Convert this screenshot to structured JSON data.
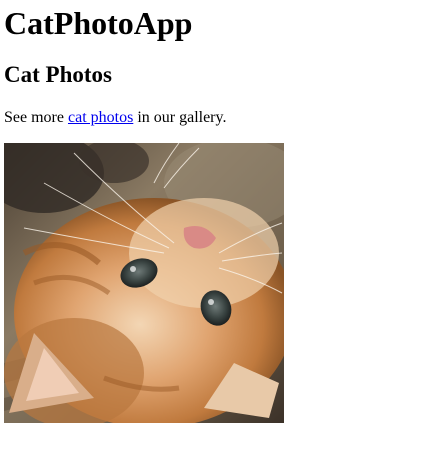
{
  "header": {
    "app_title": "CatPhotoApp"
  },
  "main": {
    "section_title": "Cat Photos",
    "intro": {
      "prefix": "See more ",
      "link_text": "cat photos",
      "suffix": " in our gallery."
    },
    "photo": {
      "alt": "A cute orange cat lying on its back."
    }
  }
}
